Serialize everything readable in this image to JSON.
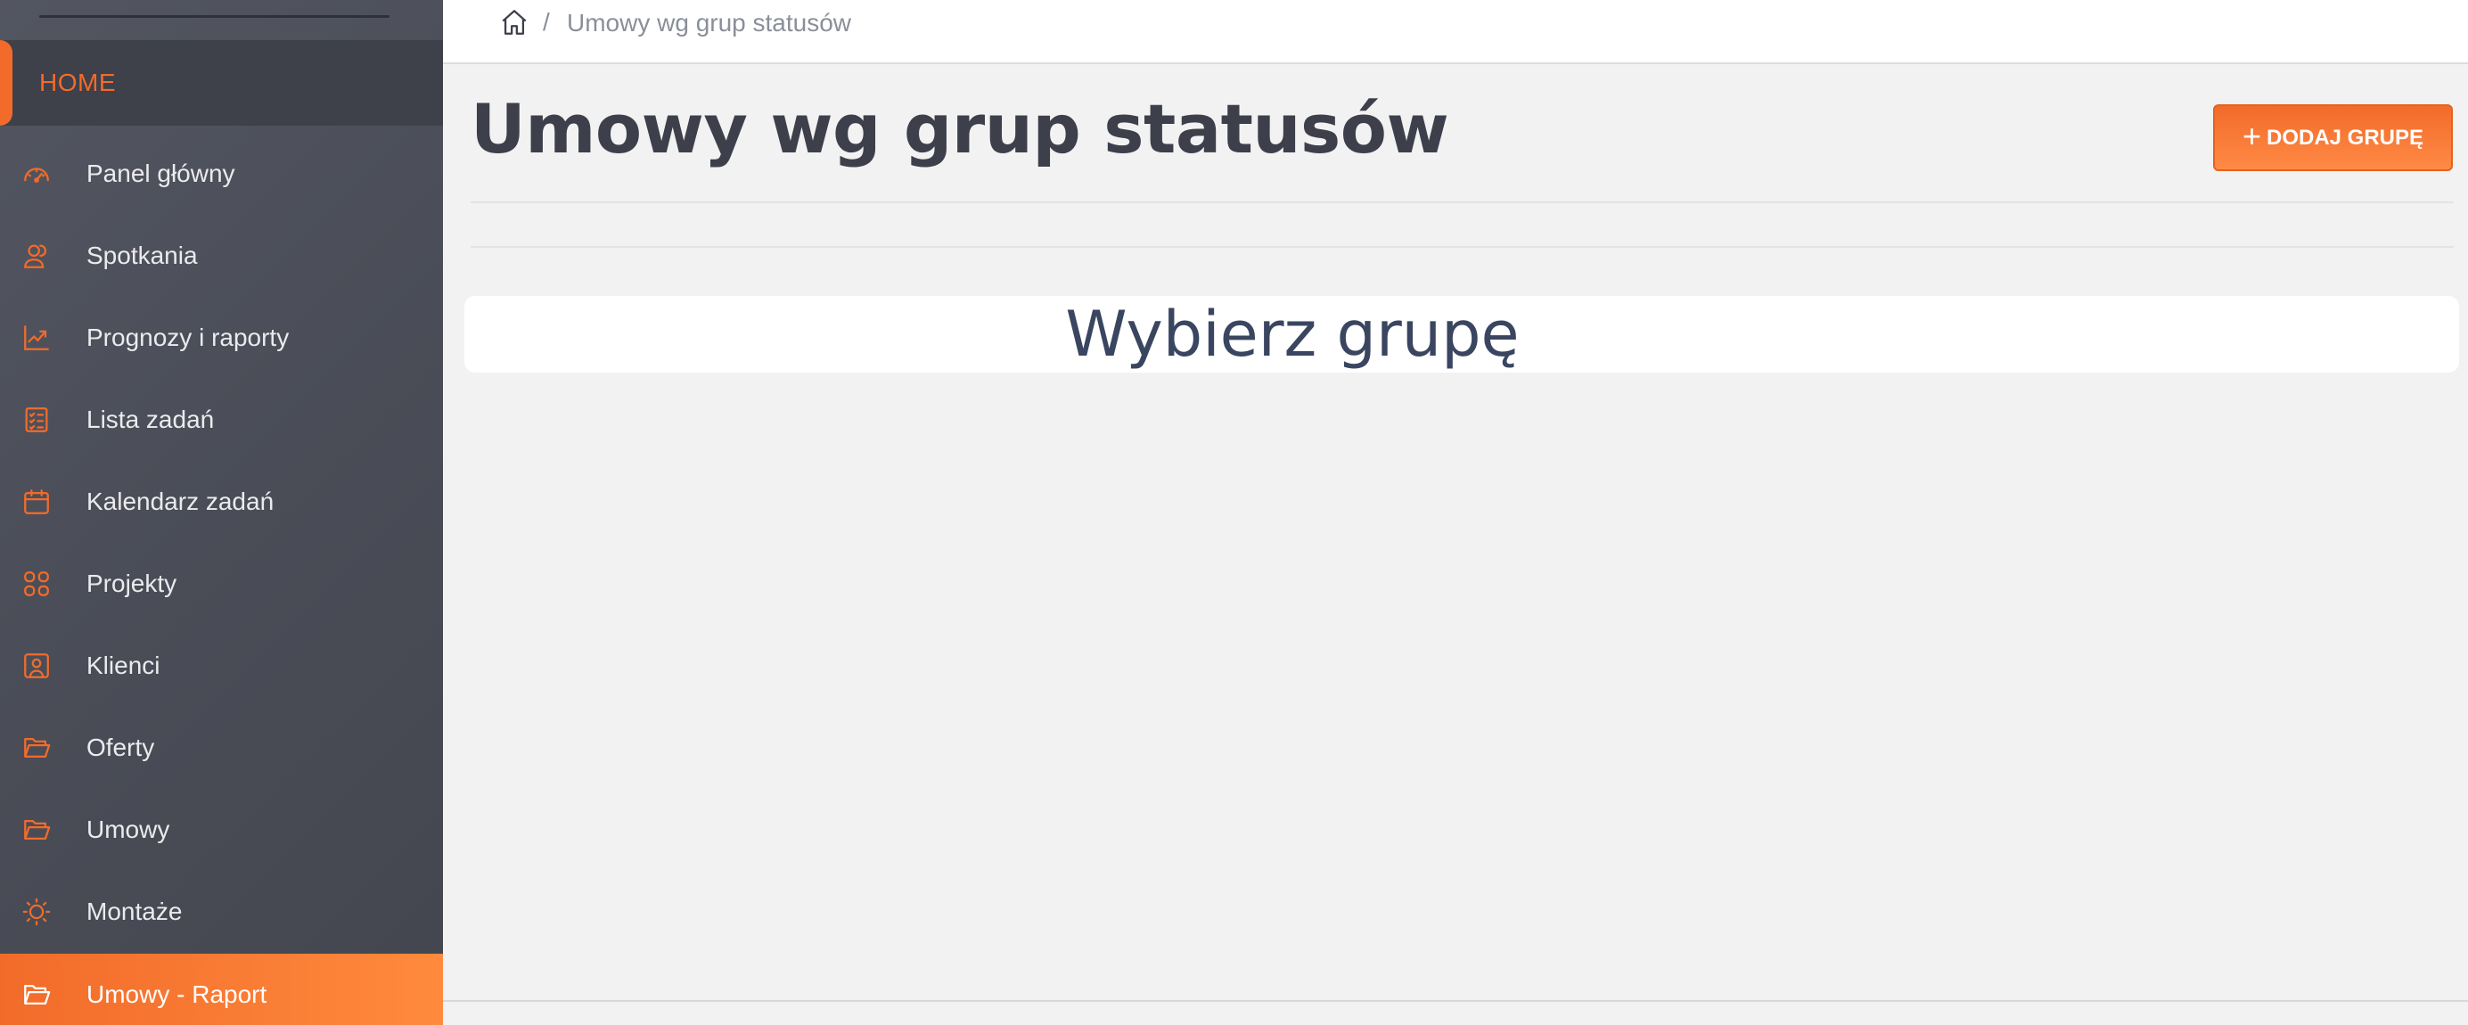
{
  "sidebar": {
    "home_label": "HOME",
    "items": [
      {
        "label": "Panel główny",
        "icon": "dashboard-gauge-icon"
      },
      {
        "label": "Spotkania",
        "icon": "people-icon"
      },
      {
        "label": "Prognozy i raporty",
        "icon": "chart-line-icon"
      },
      {
        "label": "Lista zadań",
        "icon": "checklist-icon"
      },
      {
        "label": "Kalendarz zadań",
        "icon": "calendar-icon"
      },
      {
        "label": "Projekty",
        "icon": "grid-icon"
      },
      {
        "label": "Klienci",
        "icon": "contact-card-icon"
      },
      {
        "label": "Oferty",
        "icon": "folder-open-icon"
      },
      {
        "label": "Umowy",
        "icon": "folder-open-icon"
      },
      {
        "label": "Montaże",
        "icon": "sun-icon"
      },
      {
        "label": "Umowy - Raport",
        "icon": "folder-open-icon",
        "active": true
      }
    ]
  },
  "breadcrumb": {
    "home_icon": "home-icon",
    "separator": "/",
    "current": "Umowy wg grup statusów"
  },
  "page": {
    "title": "Umowy wg grup statusów",
    "add_button_label": "DODAJ GRUPĘ",
    "add_button_icon": "plus-icon",
    "select_group_text": "Wybierz grupę"
  },
  "colors": {
    "accent": "#f26b2a",
    "sidebar_bg": "#4a4d57",
    "title": "#3d3f4b"
  }
}
